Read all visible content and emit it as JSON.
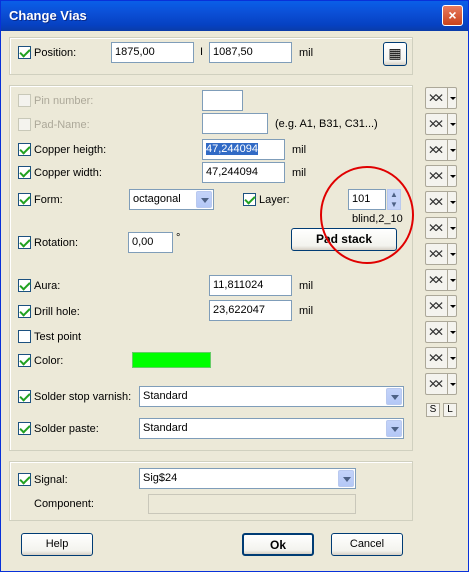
{
  "window": {
    "title": "Change Vias",
    "close": "×"
  },
  "position": {
    "label": "Position:",
    "x": "1875,00",
    "sep": "I",
    "y": "1087,50",
    "unit": "mil"
  },
  "fields": {
    "pin_number": {
      "label": "Pin number:"
    },
    "pad_name": {
      "label": "Pad-Name:",
      "hint": "(e.g. A1, B31, C31...)"
    },
    "copper_height": {
      "label": "Copper heigth:",
      "value": "47,244094",
      "unit": "mil"
    },
    "copper_width": {
      "label": "Copper width:",
      "value": "47,244094",
      "unit": "mil"
    },
    "form": {
      "label": "Form:",
      "value": "octagonal"
    },
    "layer": {
      "label": "Layer:",
      "value": "101",
      "note": "blind,2_10"
    },
    "rotation": {
      "label": "Rotation:",
      "value": "0,00",
      "unit": "°"
    },
    "pad_stack": {
      "label": "Pad stack"
    },
    "aura": {
      "label": "Aura:",
      "value": "11,811024",
      "unit": "mil"
    },
    "drill_hole": {
      "label": "Drill hole:",
      "value": "23,622047",
      "unit": "mil"
    },
    "test_point": {
      "label": "Test point"
    },
    "color": {
      "label": "Color:",
      "swatch": "#00ff00"
    },
    "solder_stop": {
      "label": "Solder stop varnish:",
      "value": "Standard"
    },
    "solder_paste": {
      "label": "Solder paste:",
      "value": "Standard"
    }
  },
  "signal": {
    "label": "Signal:",
    "value": "Sig$24",
    "component_label": "Component:"
  },
  "buttons": {
    "help": "Help",
    "ok": "Ok",
    "cancel": "Cancel"
  },
  "side": {
    "s": "S",
    "l": "L"
  },
  "annotation_color": "#e00000"
}
